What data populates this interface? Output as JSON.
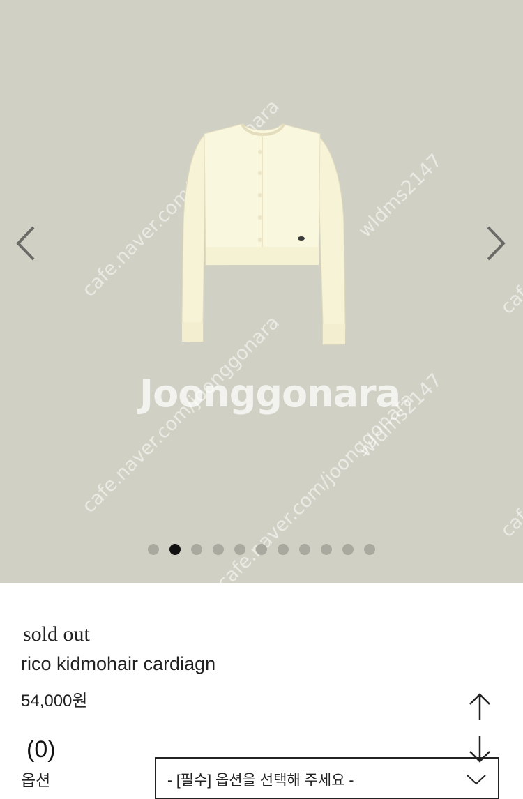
{
  "gallery": {
    "watermarks": {
      "brand": "Joonggonara",
      "site": "cafe.naver.com/joonggonara",
      "user": "wldms2147"
    },
    "slide_count": 11,
    "active_slide_index": 1,
    "background_color": "#d1d0c4"
  },
  "product": {
    "status": "sold out",
    "name": "rico kidmohair cardiagn",
    "price": "54,000원",
    "review_count": "(0)",
    "option_label": "옵션",
    "option_placeholder": "- [필수] 옵션을 선택해 주세요 -"
  },
  "icons": {
    "prev": "chevron-left-icon",
    "next": "chevron-right-icon",
    "scroll_up": "arrow-up-icon",
    "scroll_down": "arrow-down-icon",
    "dropdown": "chevron-down-icon"
  }
}
